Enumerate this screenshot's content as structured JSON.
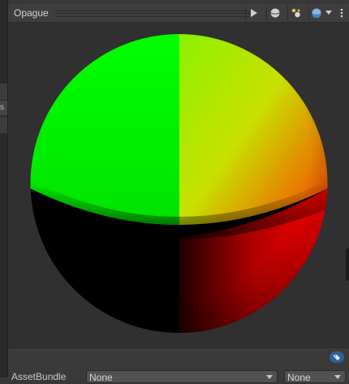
{
  "header": {
    "title": "Opague"
  },
  "toolbar": {
    "icons": [
      "play-icon",
      "sphere-mesh-icon",
      "lighting-icon",
      "background-icon",
      "dropdown-arrow-icon",
      "more-menu-icon"
    ]
  },
  "left_panel": {
    "tab_fragment": "s"
  },
  "bottom": {
    "assetbundle_label": "AssetBundle",
    "assetbundle_value": "None",
    "variant_value": "None"
  },
  "colors": {
    "background": "#383838",
    "toolbar": "#3e3e3e",
    "accent_blue": "#3d7bd9"
  }
}
